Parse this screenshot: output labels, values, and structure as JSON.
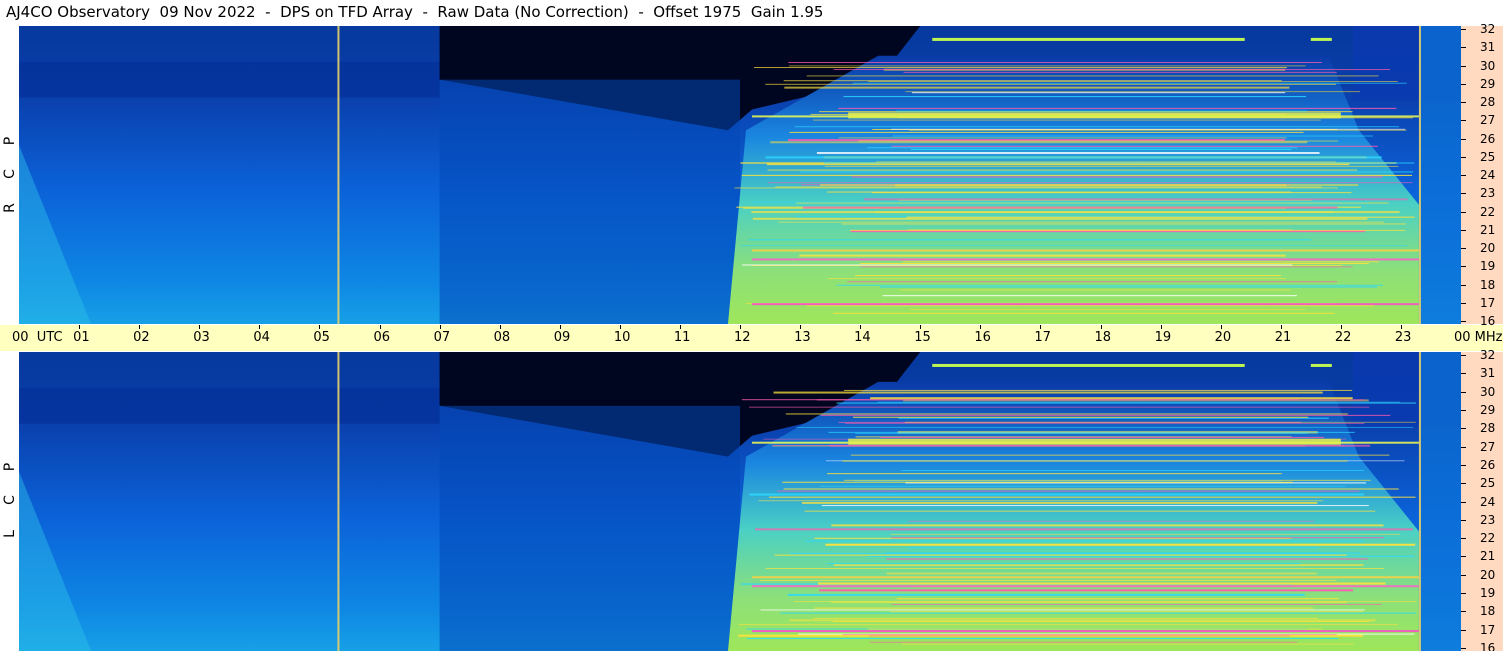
{
  "title": "AJ4CO Observatory  09 Nov 2022  -  DPS on TFD Array  -  Raw Data (No Correction)  -  Offset 1975  Gain 1.95",
  "time_axis": {
    "first_label": "00  UTC",
    "labels": [
      "01",
      "02",
      "03",
      "04",
      "05",
      "06",
      "07",
      "08",
      "09",
      "10",
      "11",
      "12",
      "13",
      "14",
      "15",
      "16",
      "17",
      "18",
      "19",
      "20",
      "21",
      "22",
      "23"
    ],
    "last_label": "00 MHz"
  },
  "panels": [
    {
      "name": "rcp",
      "polarization_letters": [
        "P",
        "C",
        "R"
      ]
    },
    {
      "name": "lcp",
      "polarization_letters": [
        "P",
        "C",
        "L"
      ]
    }
  ],
  "colors": {
    "axis_bg": "#ffffc0",
    "freq_bg": "#ffd9c0",
    "low": "#000a30",
    "mid": "#0a5ad8",
    "high": "#9ee65a",
    "peak": "#ff3ad8",
    "marker_line": "#e8d06a"
  },
  "chart_data": {
    "type": "heatmap",
    "title": "AJ4CO Observatory  09 Nov 2022  -  DPS on TFD Array  -  Raw Data (No Correction)  -  Offset 1975  Gain 1.95",
    "x_unit": "UTC",
    "y_unit": "MHz",
    "x_range": [
      0,
      24
    ],
    "y_range": [
      16,
      32
    ],
    "x_ticks": [
      "00",
      "01",
      "02",
      "03",
      "04",
      "05",
      "06",
      "07",
      "08",
      "09",
      "10",
      "11",
      "12",
      "13",
      "14",
      "15",
      "16",
      "17",
      "18",
      "19",
      "20",
      "21",
      "22",
      "23",
      "00"
    ],
    "y_ticks": [
      "16",
      "17",
      "18",
      "19",
      "20",
      "21",
      "22",
      "23",
      "24",
      "25",
      "26",
      "27",
      "28",
      "29",
      "30",
      "31",
      "32"
    ],
    "panels": [
      "RCP",
      "LCP"
    ],
    "vertical_markers_utc": [
      5.3,
      23.3
    ]
  }
}
